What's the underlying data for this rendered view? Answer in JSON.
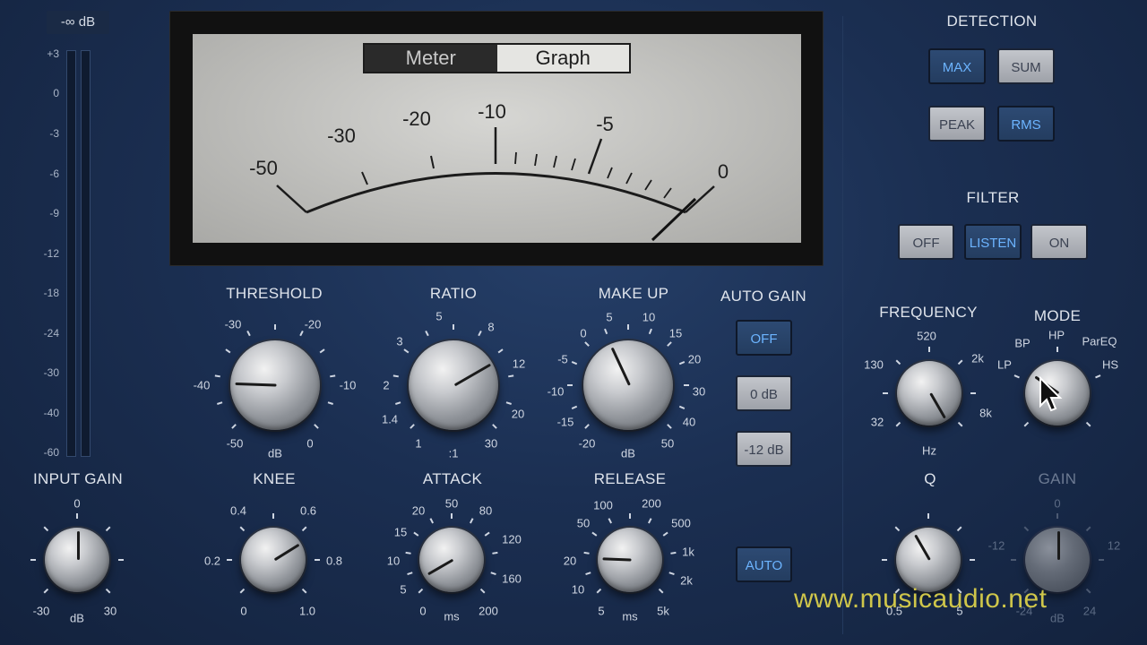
{
  "input_meter": {
    "readout": "-∞ dB",
    "scale": [
      "+3",
      "0",
      "-3",
      "-6",
      "-9",
      "-12",
      "-18",
      "-24",
      "-30",
      "-40",
      "-60"
    ]
  },
  "display": {
    "tabs": [
      "Meter",
      "Graph"
    ],
    "selected_tab": "Graph",
    "vu_labels": [
      "-50",
      "-30",
      "-20",
      "-10",
      "-5",
      "0"
    ]
  },
  "knobs": {
    "threshold": {
      "label": "THRESHOLD",
      "ticks": [
        "-30",
        "-20",
        "-40",
        "-10",
        "-50",
        "0"
      ],
      "unit": "dB"
    },
    "ratio": {
      "label": "RATIO",
      "ticks": [
        "5",
        "8",
        "3",
        "12",
        "2",
        "20",
        "1.4",
        "1",
        "30"
      ],
      "unit": ":1"
    },
    "makeup": {
      "label": "MAKE UP",
      "ticks": [
        "5",
        "10",
        "0",
        "15",
        "-5",
        "20",
        "-10",
        "30",
        "-15",
        "40",
        "-20",
        "50"
      ],
      "unit": "dB"
    },
    "input_gain": {
      "label": "INPUT GAIN",
      "ticks": [
        "0",
        "-30",
        "30"
      ],
      "unit": "dB"
    },
    "knee": {
      "label": "KNEE",
      "ticks": [
        "0.4",
        "0.6",
        "0.2",
        "0.8",
        "0",
        "1.0"
      ]
    },
    "attack": {
      "label": "ATTACK",
      "ticks": [
        "50",
        "20",
        "80",
        "15",
        "120",
        "10",
        "160",
        "5",
        "0",
        "200"
      ],
      "unit": "ms"
    },
    "release": {
      "label": "RELEASE",
      "ticks": [
        "100",
        "200",
        "50",
        "500",
        "1k",
        "20",
        "2k",
        "10",
        "5",
        "5k"
      ],
      "unit": "ms"
    },
    "frequency": {
      "label": "FREQUENCY",
      "ticks": [
        "520",
        "130",
        "2k",
        "32",
        "8k"
      ],
      "unit": "Hz"
    },
    "mode": {
      "label": "MODE",
      "ticks": [
        "HP",
        "BP",
        "ParEQ",
        "LP",
        "HS"
      ]
    },
    "q": {
      "label": "Q",
      "ticks": [
        "0.5",
        "5"
      ]
    },
    "gain": {
      "label": "GAIN",
      "ticks": [
        "0",
        "-12",
        "12",
        "-24",
        "24"
      ],
      "unit": "dB"
    }
  },
  "auto_gain": {
    "label": "AUTO GAIN",
    "buttons": [
      "OFF",
      "0 dB",
      "-12 dB"
    ],
    "selected": "OFF",
    "auto_button": "AUTO"
  },
  "detection": {
    "label": "DETECTION",
    "buttons": [
      "MAX",
      "SUM",
      "PEAK",
      "RMS"
    ],
    "selected": [
      "MAX",
      "RMS"
    ]
  },
  "filter": {
    "label": "FILTER",
    "buttons": [
      "OFF",
      "LISTEN",
      "ON"
    ],
    "selected": "LISTEN"
  },
  "watermark": "www.musicaudio.net",
  "colors": {
    "active_text": "#6cb4ff",
    "panel_bg": "#1b2f52",
    "watermark": "#cfc64a"
  }
}
